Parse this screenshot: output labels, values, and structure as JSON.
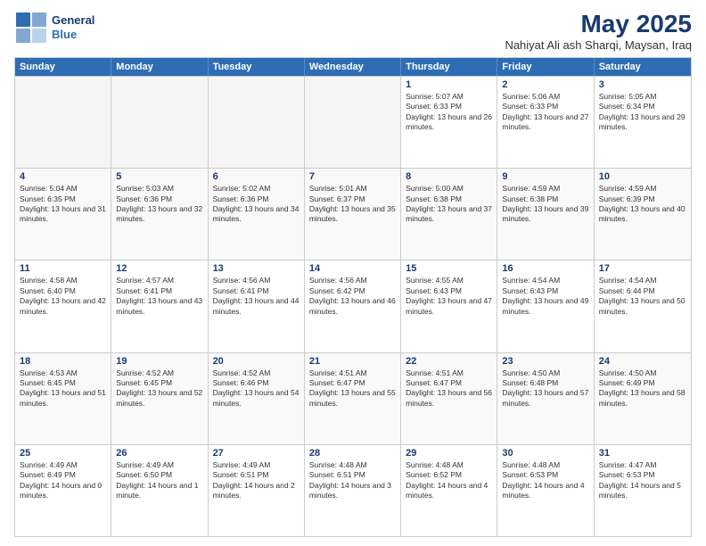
{
  "logo": {
    "line1": "General",
    "line2": "Blue"
  },
  "title": "May 2025",
  "subtitle": "Nahiyat Ali ash Sharqi, Maysan, Iraq",
  "header_days": [
    "Sunday",
    "Monday",
    "Tuesday",
    "Wednesday",
    "Thursday",
    "Friday",
    "Saturday"
  ],
  "rows": [
    [
      {
        "day": "",
        "empty": true
      },
      {
        "day": "",
        "empty": true
      },
      {
        "day": "",
        "empty": true
      },
      {
        "day": "",
        "empty": true
      },
      {
        "day": "1",
        "rise": "5:07 AM",
        "set": "6:33 PM",
        "daylight": "13 hours and 26 minutes."
      },
      {
        "day": "2",
        "rise": "5:06 AM",
        "set": "6:33 PM",
        "daylight": "13 hours and 27 minutes."
      },
      {
        "day": "3",
        "rise": "5:05 AM",
        "set": "6:34 PM",
        "daylight": "13 hours and 29 minutes."
      }
    ],
    [
      {
        "day": "4",
        "rise": "5:04 AM",
        "set": "6:35 PM",
        "daylight": "13 hours and 31 minutes."
      },
      {
        "day": "5",
        "rise": "5:03 AM",
        "set": "6:36 PM",
        "daylight": "13 hours and 32 minutes."
      },
      {
        "day": "6",
        "rise": "5:02 AM",
        "set": "6:36 PM",
        "daylight": "13 hours and 34 minutes."
      },
      {
        "day": "7",
        "rise": "5:01 AM",
        "set": "6:37 PM",
        "daylight": "13 hours and 35 minutes."
      },
      {
        "day": "8",
        "rise": "5:00 AM",
        "set": "6:38 PM",
        "daylight": "13 hours and 37 minutes."
      },
      {
        "day": "9",
        "rise": "4:59 AM",
        "set": "6:38 PM",
        "daylight": "13 hours and 39 minutes."
      },
      {
        "day": "10",
        "rise": "4:59 AM",
        "set": "6:39 PM",
        "daylight": "13 hours and 40 minutes."
      }
    ],
    [
      {
        "day": "11",
        "rise": "4:58 AM",
        "set": "6:40 PM",
        "daylight": "13 hours and 42 minutes."
      },
      {
        "day": "12",
        "rise": "4:57 AM",
        "set": "6:41 PM",
        "daylight": "13 hours and 43 minutes."
      },
      {
        "day": "13",
        "rise": "4:56 AM",
        "set": "6:41 PM",
        "daylight": "13 hours and 44 minutes."
      },
      {
        "day": "14",
        "rise": "4:56 AM",
        "set": "6:42 PM",
        "daylight": "13 hours and 46 minutes."
      },
      {
        "day": "15",
        "rise": "4:55 AM",
        "set": "6:43 PM",
        "daylight": "13 hours and 47 minutes."
      },
      {
        "day": "16",
        "rise": "4:54 AM",
        "set": "6:43 PM",
        "daylight": "13 hours and 49 minutes."
      },
      {
        "day": "17",
        "rise": "4:54 AM",
        "set": "6:44 PM",
        "daylight": "13 hours and 50 minutes."
      }
    ],
    [
      {
        "day": "18",
        "rise": "4:53 AM",
        "set": "6:45 PM",
        "daylight": "13 hours and 51 minutes."
      },
      {
        "day": "19",
        "rise": "4:52 AM",
        "set": "6:45 PM",
        "daylight": "13 hours and 52 minutes."
      },
      {
        "day": "20",
        "rise": "4:52 AM",
        "set": "6:46 PM",
        "daylight": "13 hours and 54 minutes."
      },
      {
        "day": "21",
        "rise": "4:51 AM",
        "set": "6:47 PM",
        "daylight": "13 hours and 55 minutes."
      },
      {
        "day": "22",
        "rise": "4:51 AM",
        "set": "6:47 PM",
        "daylight": "13 hours and 56 minutes."
      },
      {
        "day": "23",
        "rise": "4:50 AM",
        "set": "6:48 PM",
        "daylight": "13 hours and 57 minutes."
      },
      {
        "day": "24",
        "rise": "4:50 AM",
        "set": "6:49 PM",
        "daylight": "13 hours and 58 minutes."
      }
    ],
    [
      {
        "day": "25",
        "rise": "4:49 AM",
        "set": "6:49 PM",
        "daylight": "14 hours and 0 minutes."
      },
      {
        "day": "26",
        "rise": "4:49 AM",
        "set": "6:50 PM",
        "daylight": "14 hours and 1 minute."
      },
      {
        "day": "27",
        "rise": "4:49 AM",
        "set": "6:51 PM",
        "daylight": "14 hours and 2 minutes."
      },
      {
        "day": "28",
        "rise": "4:48 AM",
        "set": "6:51 PM",
        "daylight": "14 hours and 3 minutes."
      },
      {
        "day": "29",
        "rise": "4:48 AM",
        "set": "6:52 PM",
        "daylight": "14 hours and 4 minutes."
      },
      {
        "day": "30",
        "rise": "4:48 AM",
        "set": "6:53 PM",
        "daylight": "14 hours and 4 minutes."
      },
      {
        "day": "31",
        "rise": "4:47 AM",
        "set": "6:53 PM",
        "daylight": "14 hours and 5 minutes."
      }
    ]
  ]
}
